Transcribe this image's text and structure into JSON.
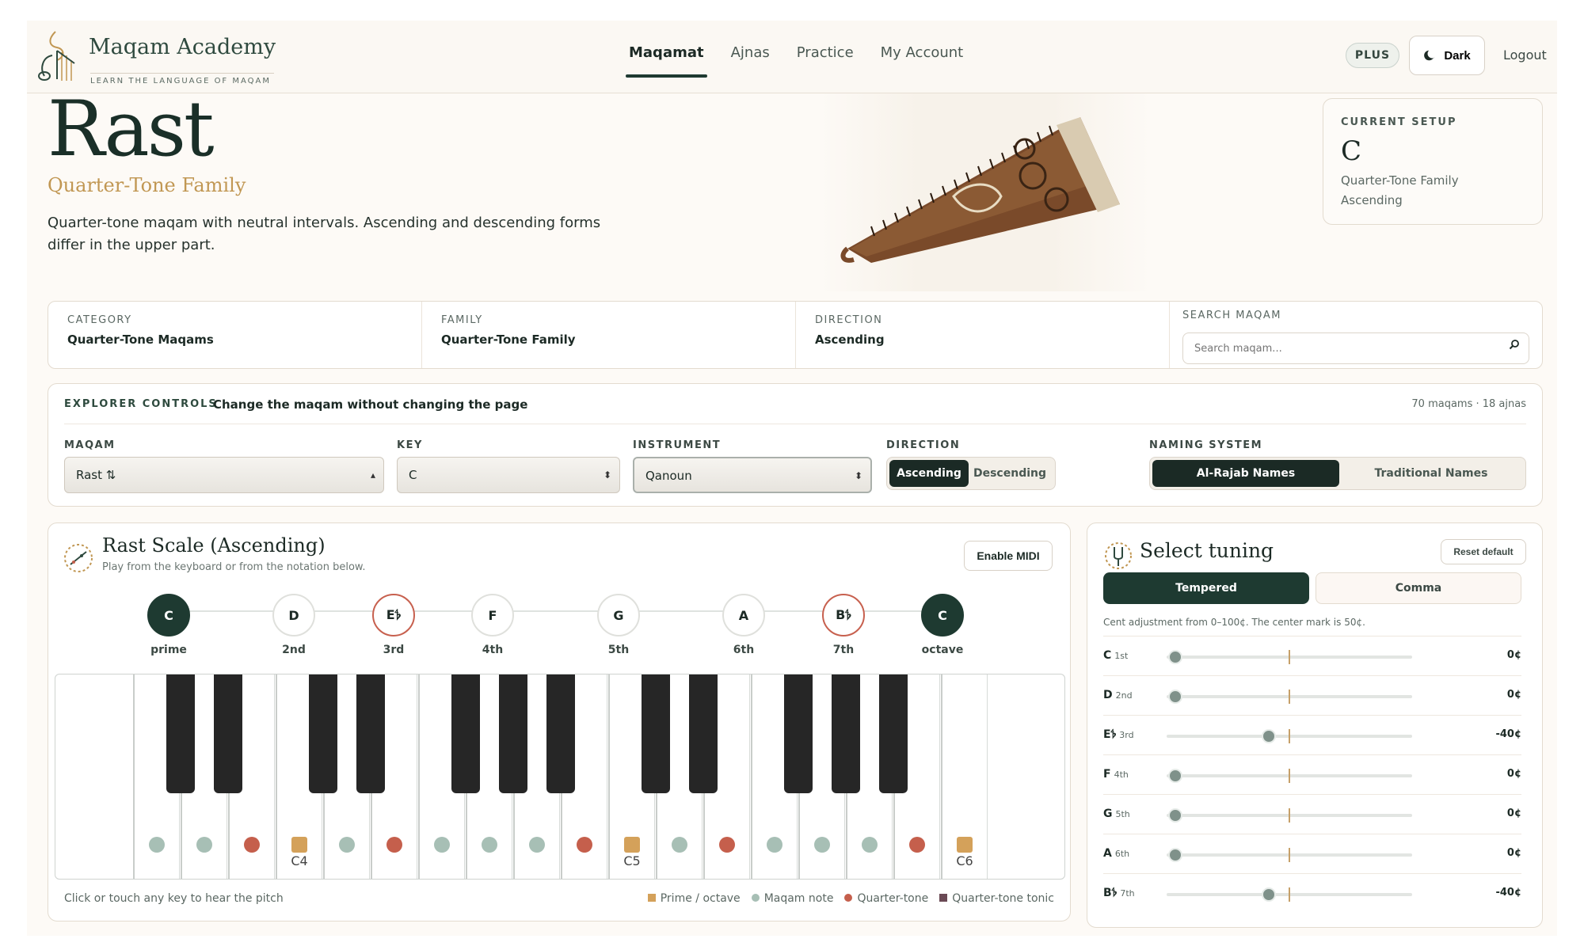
{
  "header": {
    "brand": "Maqam Academy",
    "tagline": "LEARN THE LANGUAGE OF MAQAM",
    "nav": [
      "Maqamat",
      "Ajnas",
      "Practice",
      "My Account"
    ],
    "active_nav": "Maqamat",
    "plus_badge": "PLUS",
    "theme_button": "Dark",
    "logout": "Logout"
  },
  "hero": {
    "title": "Rast",
    "subtitle": "Quarter-Tone Family",
    "description": "Quarter-tone maqam with neutral intervals. Ascending and descending forms differ in the upper part."
  },
  "current_setup": {
    "label": "CURRENT SETUP",
    "key": "C",
    "family": "Quarter-Tone Family",
    "direction": "Ascending"
  },
  "info": {
    "category_label": "CATEGORY",
    "category": "Quarter-Tone Maqams",
    "family_label": "FAMILY",
    "family": "Quarter-Tone Family",
    "direction_label": "DIRECTION",
    "direction": "Ascending",
    "search_label": "SEARCH MAQAM",
    "search_placeholder": "Search maqam..."
  },
  "explorer": {
    "heading": "EXPLORER CONTROLS",
    "description": "Change the maqam without changing the page",
    "count": "70 maqams · 18 ajnas",
    "maqam_label": "MAQAM",
    "maqam_value": "Rast ⇅",
    "key_label": "KEY",
    "key_value": "C",
    "instrument_label": "INSTRUMENT",
    "instrument_value": "Qanoun",
    "direction_label": "DIRECTION",
    "direction_options": [
      "Ascending",
      "Descending"
    ],
    "direction_selected": "Ascending",
    "naming_label": "NAMING SYSTEM",
    "naming_options": [
      "Al-Rajab Names",
      "Traditional Names"
    ],
    "naming_selected": "Al-Rajab Names"
  },
  "scale": {
    "title": "Rast Scale (Ascending)",
    "subtitle": "Play from the keyboard or from the notation below.",
    "midi_button": "Enable MIDI",
    "notes": [
      {
        "name": "C",
        "degree": "prime",
        "type": "tonic"
      },
      {
        "name": "D",
        "degree": "2nd",
        "type": "normal"
      },
      {
        "name": "E𝄳",
        "degree": "3rd",
        "type": "quarter"
      },
      {
        "name": "F",
        "degree": "4th",
        "type": "normal"
      },
      {
        "name": "G",
        "degree": "5th",
        "type": "normal"
      },
      {
        "name": "A",
        "degree": "6th",
        "type": "normal"
      },
      {
        "name": "B𝄳",
        "degree": "7th",
        "type": "quarter"
      },
      {
        "name": "C",
        "degree": "octave",
        "type": "tonic"
      }
    ],
    "keyboard_labels": {
      "C4": "C4",
      "C5": "C5",
      "C6": "C6"
    },
    "hint": "Click or touch any key to hear the pitch",
    "legend": [
      {
        "label": "Prime / octave",
        "color": "#d4a15a"
      },
      {
        "label": "Maqam note",
        "color": "#a7bfb5"
      },
      {
        "label": "Quarter-tone",
        "color": "#c55f4c"
      },
      {
        "label": "Quarter-tone tonic",
        "color": "#6b4a55"
      }
    ]
  },
  "tuning": {
    "title": "Select tuning",
    "reset": "Reset default",
    "modes": [
      "Tempered",
      "Comma"
    ],
    "mode_selected": "Tempered",
    "note": "Cent adjustment from 0–100¢. The center mark is 50¢.",
    "rows": [
      {
        "note": "C",
        "ord": "1st",
        "value": "0¢",
        "cents": 0
      },
      {
        "note": "D",
        "ord": "2nd",
        "value": "0¢",
        "cents": 0
      },
      {
        "note": "E𝄳",
        "ord": "3rd",
        "value": "-40¢",
        "cents": 40
      },
      {
        "note": "F",
        "ord": "4th",
        "value": "0¢",
        "cents": 0
      },
      {
        "note": "G",
        "ord": "5th",
        "value": "0¢",
        "cents": 0
      },
      {
        "note": "A",
        "ord": "6th",
        "value": "0¢",
        "cents": 0
      },
      {
        "note": "B𝄳",
        "ord": "7th",
        "value": "-40¢",
        "cents": 40
      }
    ]
  },
  "colors": {
    "accent": "#1e3a31",
    "gold": "#c19753",
    "quarter_tone": "#c55f4c",
    "maqam_note": "#a7bfb5"
  }
}
